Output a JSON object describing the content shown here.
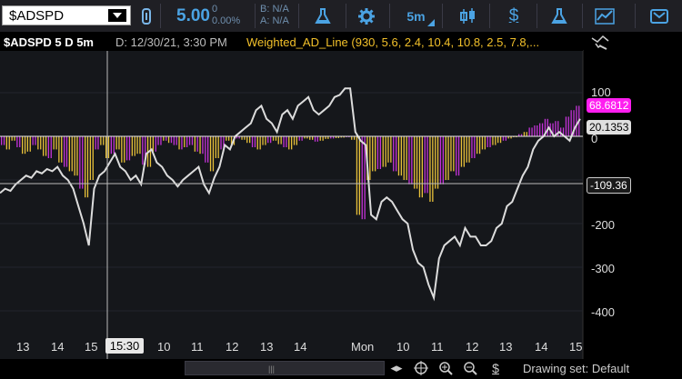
{
  "toolbar": {
    "symbol": "$ADSPD",
    "last": "5.00",
    "change": "0",
    "change_pct": "0.00%",
    "bid": "B: N/A",
    "ask": "A: N/A",
    "timeframe": "5m",
    "dollar": "$",
    "icons": [
      "link-icon",
      "flask-icon",
      "gear-icon",
      "candles-icon",
      "dollar-icon",
      "flask-icon",
      "chart-style-icon",
      "share-icon"
    ]
  },
  "chart": {
    "title": "$ADSPD 5 D 5m",
    "date": "D: 12/30/21, 3:30 PM",
    "study": "Weighted_AD_Line (930, 5.6, 2.4, 10.4, 10.8, 2.5, 7.8,...",
    "y_ticks": [
      "100",
      "0",
      "-100",
      "-200",
      "-300",
      "-400"
    ],
    "x_ticks": [
      "13",
      "14",
      "15",
      "10",
      "11",
      "12",
      "13",
      "14",
      "Mon",
      "10",
      "11",
      "12",
      "13",
      "14",
      "15"
    ],
    "cursor_time": "15:30",
    "tag_magenta": "68.6812",
    "tag_white": "20.1353",
    "tag_cursor": "-109.36",
    "drawing_set": "Drawing set: Default",
    "colors": {
      "line": "#dcdcdc",
      "hist_up": "#e23ce6",
      "hist_yellow": "#e8c13a",
      "tag_magenta": "#ff1ef0"
    }
  },
  "chart_data": {
    "type": "line",
    "yticks": [
      100,
      0,
      -100,
      -200,
      -300,
      -400
    ],
    "line_series": [
      -130,
      -120,
      -125,
      -110,
      -100,
      -90,
      -95,
      -80,
      -85,
      -75,
      -80,
      -70,
      -90,
      -100,
      -120,
      -160,
      -200,
      -250,
      -120,
      -90,
      -80,
      -60,
      -40,
      -70,
      -80,
      -100,
      -90,
      -110,
      -40,
      -30,
      -60,
      -70,
      -90,
      -100,
      -115,
      -100,
      -90,
      -80,
      -70,
      -110,
      -130,
      -95,
      -70,
      -20,
      -30,
      0,
      10,
      20,
      30,
      60,
      70,
      40,
      30,
      10,
      50,
      60,
      40,
      70,
      80,
      90,
      60,
      50,
      60,
      70,
      90,
      95,
      110,
      110,
      10,
      -10,
      -20,
      -180,
      -190,
      -150,
      -140,
      -150,
      -170,
      -190,
      -200,
      -260,
      -290,
      -300,
      -340,
      -370,
      -280,
      -250,
      -240,
      -230,
      -250,
      -210,
      -230,
      -230,
      -250,
      -250,
      -240,
      -210,
      -200,
      -160,
      -150,
      -120,
      -90,
      -70,
      -30,
      -10,
      0,
      20,
      0,
      10,
      0,
      -10,
      20,
      40
    ],
    "hist_series": [
      -20,
      -30,
      -10,
      -25,
      -40,
      -35,
      -20,
      -30,
      -45,
      -50,
      -30,
      -60,
      -70,
      -80,
      -90,
      -120,
      -140,
      -100,
      -30,
      -20,
      -50,
      -40,
      -30,
      -60,
      -55,
      -45,
      -40,
      -65,
      -70,
      -35,
      -20,
      -10,
      -15,
      -20,
      -30,
      -25,
      -20,
      -35,
      -40,
      -60,
      -80,
      -50,
      -30,
      -10,
      -20,
      -5,
      -8,
      -15,
      -25,
      -30,
      -20,
      -15,
      -10,
      -18,
      -25,
      -30,
      -20,
      -10,
      -5,
      -8,
      -12,
      -10,
      -6,
      -5,
      -4,
      -3,
      -2,
      -8,
      -180,
      -190,
      -100,
      -80,
      -75,
      -70,
      -60,
      -80,
      -90,
      -100,
      -110,
      -120,
      -140,
      -130,
      -150,
      -120,
      -110,
      -100,
      -80,
      -90,
      -70,
      -60,
      -50,
      -40,
      -30,
      -25,
      -20,
      -15,
      -10,
      -5,
      -2,
      5,
      10,
      20,
      25,
      30,
      40,
      30,
      35,
      20,
      45,
      60,
      70
    ],
    "ylim": [
      -420,
      110
    ]
  }
}
